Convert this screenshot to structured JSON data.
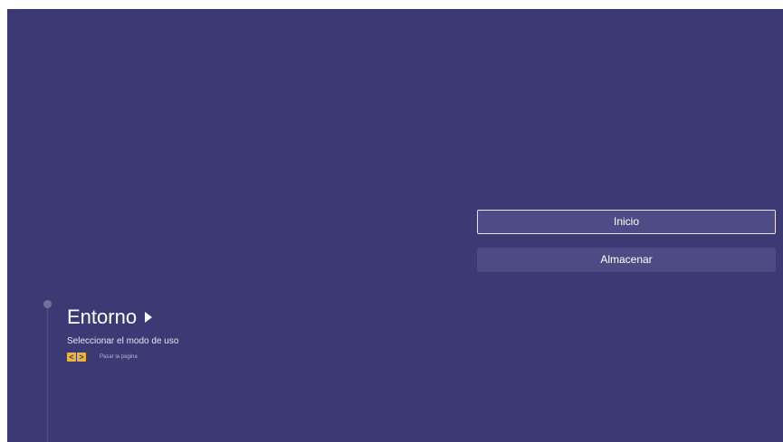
{
  "step": {
    "title": "Entorno",
    "subtitle": "Seleccionar el modo de uso",
    "hint_keys": {
      "left": "<",
      "right": ">"
    },
    "hint_text": "Pasar la página"
  },
  "options": {
    "items": [
      {
        "label": "Inicio",
        "selected": true
      },
      {
        "label": "Almacenar",
        "selected": false
      }
    ]
  },
  "colors": {
    "background": "#3b3a74",
    "button": "#4c4b84",
    "accent_key": "#f0b43c"
  }
}
